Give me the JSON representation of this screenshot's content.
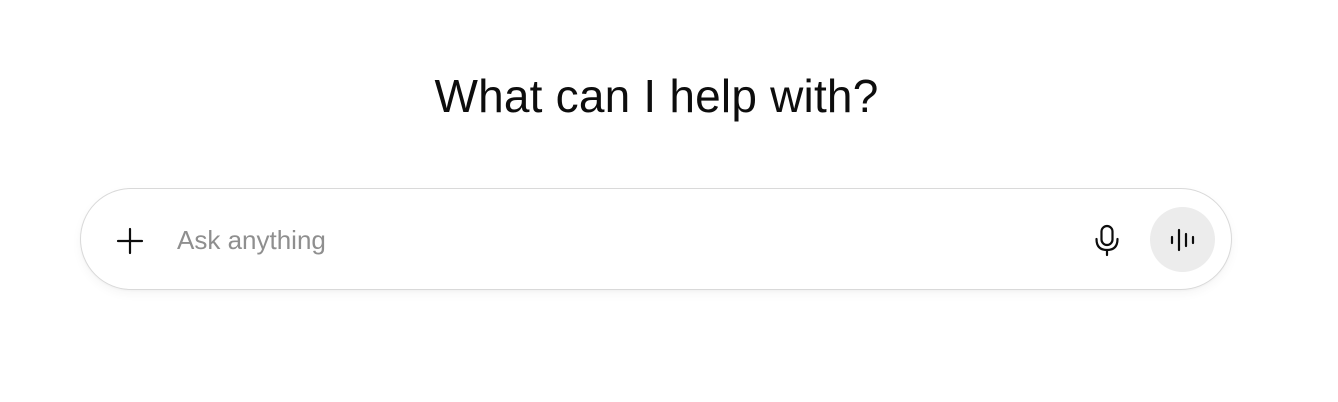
{
  "main": {
    "heading": "What can I help with?"
  },
  "composer": {
    "placeholder": "Ask anything",
    "value": "",
    "icons": {
      "attach": "plus-icon",
      "dictate": "microphone-icon",
      "voice_mode": "voice-waveform-icon"
    }
  },
  "colors": {
    "background": "#ffffff",
    "text": "#0d0d0d",
    "placeholder": "#8f8f8f",
    "composer_border": "#d9d9d9",
    "voice_button_bg": "#ececec"
  }
}
